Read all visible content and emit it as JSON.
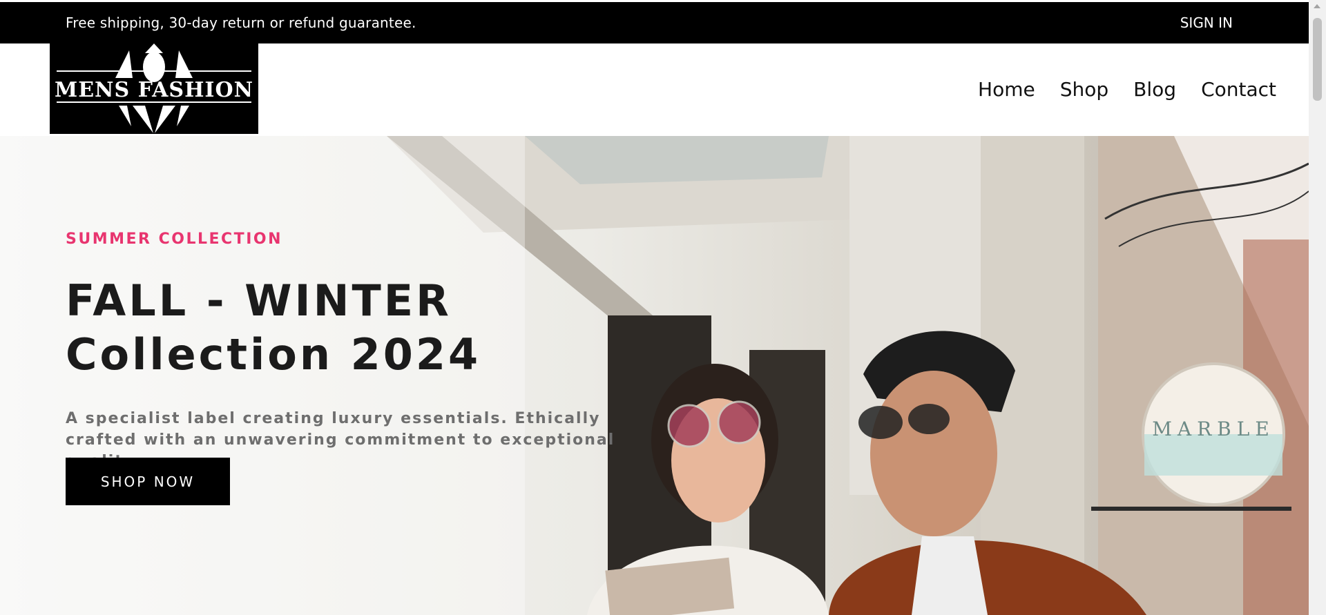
{
  "topbar": {
    "promo": "Free shipping, 30-day return or refund guarantee.",
    "signin": "SIGN IN"
  },
  "logo": {
    "text": "MENS FASHION"
  },
  "nav": {
    "items": [
      {
        "label": "Home"
      },
      {
        "label": "Shop"
      },
      {
        "label": "Blog"
      },
      {
        "label": "Contact"
      }
    ]
  },
  "hero": {
    "subtitle": "SUMMER COLLECTION",
    "title_line1": "FALL - WINTER",
    "title_line2": "Collection 2024",
    "description": "A specialist label creating luxury essentials. Ethically crafted with an unwavering commitment to exceptional quality.",
    "cta": "SHOP NOW",
    "sign_text": "MARBLE"
  },
  "colors": {
    "accent": "#e8356f",
    "dark": "#000000",
    "text": "#1b1b1b"
  }
}
